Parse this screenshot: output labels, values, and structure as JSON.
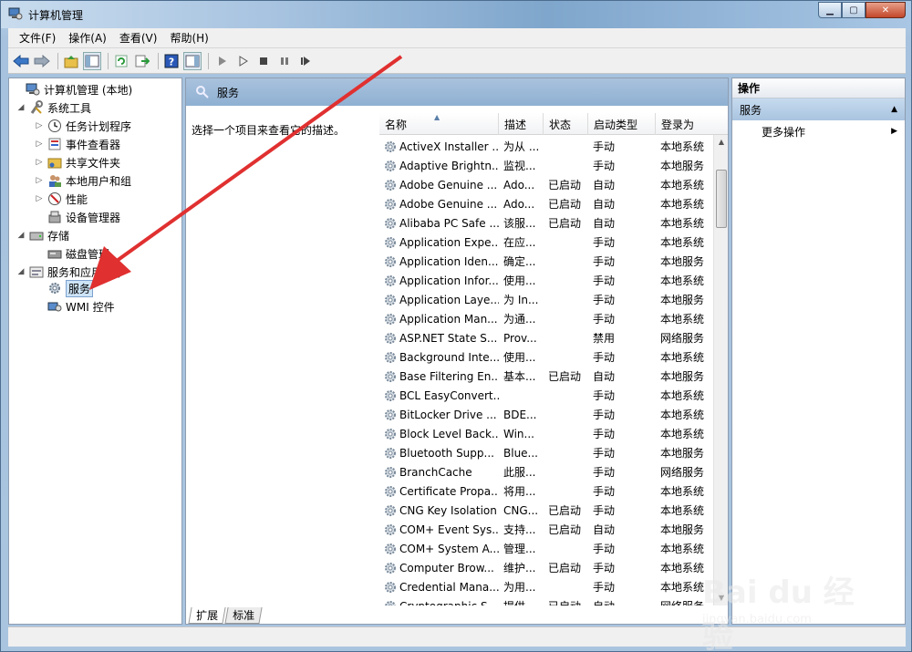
{
  "window": {
    "title": "计算机管理"
  },
  "menu": [
    "文件(F)",
    "操作(A)",
    "查看(V)",
    "帮助(H)"
  ],
  "tree": [
    {
      "label": "计算机管理 (本地)",
      "level": 0,
      "expander": "",
      "icon": "computer-icon"
    },
    {
      "label": "系统工具",
      "level": 1,
      "expander": "◢",
      "icon": "tools-icon"
    },
    {
      "label": "任务计划程序",
      "level": 2,
      "expander": "▷",
      "icon": "clock-icon"
    },
    {
      "label": "事件查看器",
      "level": 2,
      "expander": "▷",
      "icon": "event-viewer-icon"
    },
    {
      "label": "共享文件夹",
      "level": 2,
      "expander": "▷",
      "icon": "shared-folder-icon"
    },
    {
      "label": "本地用户和组",
      "level": 2,
      "expander": "▷",
      "icon": "users-icon"
    },
    {
      "label": "性能",
      "level": 2,
      "expander": "▷",
      "icon": "performance-icon"
    },
    {
      "label": "设备管理器",
      "level": 2,
      "expander": "",
      "icon": "device-manager-icon"
    },
    {
      "label": "存储",
      "level": 1,
      "expander": "◢",
      "icon": "storage-icon"
    },
    {
      "label": "磁盘管理",
      "level": 2,
      "expander": "",
      "icon": "disk-icon"
    },
    {
      "label": "服务和应用程序",
      "level": 1,
      "expander": "◢",
      "icon": "services-apps-icon"
    },
    {
      "label": "服务",
      "level": 2,
      "expander": "",
      "icon": "gear-icon",
      "selected": true
    },
    {
      "label": "WMI 控件",
      "level": 2,
      "expander": "",
      "icon": "wmi-icon"
    }
  ],
  "center": {
    "header": "服务",
    "description_prompt": "选择一个项目来查看它的描述。",
    "columns": [
      "名称",
      "描述",
      "状态",
      "启动类型",
      "登录为"
    ],
    "rows": [
      [
        "ActiveX Installer ...",
        "为从 ...",
        "",
        "手动",
        "本地系统"
      ],
      [
        "Adaptive Brightn...",
        "监视...",
        "",
        "手动",
        "本地服务"
      ],
      [
        "Adobe Genuine ...",
        "Ado...",
        "已启动",
        "自动",
        "本地系统"
      ],
      [
        "Adobe Genuine ...",
        "Ado...",
        "已启动",
        "自动",
        "本地系统"
      ],
      [
        "Alibaba PC Safe ...",
        "该服...",
        "已启动",
        "自动",
        "本地系统"
      ],
      [
        "Application Expe...",
        "在应...",
        "",
        "手动",
        "本地系统"
      ],
      [
        "Application Iden...",
        "确定...",
        "",
        "手动",
        "本地服务"
      ],
      [
        "Application Infor...",
        "使用...",
        "",
        "手动",
        "本地系统"
      ],
      [
        "Application Laye...",
        "为 In...",
        "",
        "手动",
        "本地服务"
      ],
      [
        "Application Man...",
        "为通...",
        "",
        "手动",
        "本地系统"
      ],
      [
        "ASP.NET State S...",
        "Prov...",
        "",
        "禁用",
        "网络服务"
      ],
      [
        "Background Inte...",
        "使用...",
        "",
        "手动",
        "本地系统"
      ],
      [
        "Base Filtering En...",
        "基本...",
        "已启动",
        "自动",
        "本地服务"
      ],
      [
        "BCL EasyConvert...",
        "",
        "",
        "手动",
        "本地系统"
      ],
      [
        "BitLocker Drive ...",
        "BDE...",
        "",
        "手动",
        "本地系统"
      ],
      [
        "Block Level Back...",
        "Win...",
        "",
        "手动",
        "本地系统"
      ],
      [
        "Bluetooth Supp...",
        "Blue...",
        "",
        "手动",
        "本地服务"
      ],
      [
        "BranchCache",
        "此服...",
        "",
        "手动",
        "网络服务"
      ],
      [
        "Certificate Propa...",
        "将用...",
        "",
        "手动",
        "本地系统"
      ],
      [
        "CNG Key Isolation",
        "CNG...",
        "已启动",
        "手动",
        "本地系统"
      ],
      [
        "COM+ Event Sys...",
        "支持...",
        "已启动",
        "自动",
        "本地服务"
      ],
      [
        "COM+ System A...",
        "管理...",
        "",
        "手动",
        "本地系统"
      ],
      [
        "Computer Brow...",
        "维护...",
        "已启动",
        "手动",
        "本地系统"
      ],
      [
        "Credential Mana...",
        "为用...",
        "",
        "手动",
        "本地系统"
      ],
      [
        "Cryptographic S...",
        "提供...",
        "已启动",
        "自动",
        "网络服务"
      ]
    ],
    "tabs": [
      "扩展",
      "标准"
    ]
  },
  "actions": {
    "title": "操作",
    "group": "服务",
    "more": "更多操作"
  },
  "watermark": {
    "logo": "Bai du 经验",
    "url": "jingyan.baidu.com"
  },
  "colors": {
    "annotation_arrow": "#e03030",
    "selection": "#cde4f7"
  }
}
